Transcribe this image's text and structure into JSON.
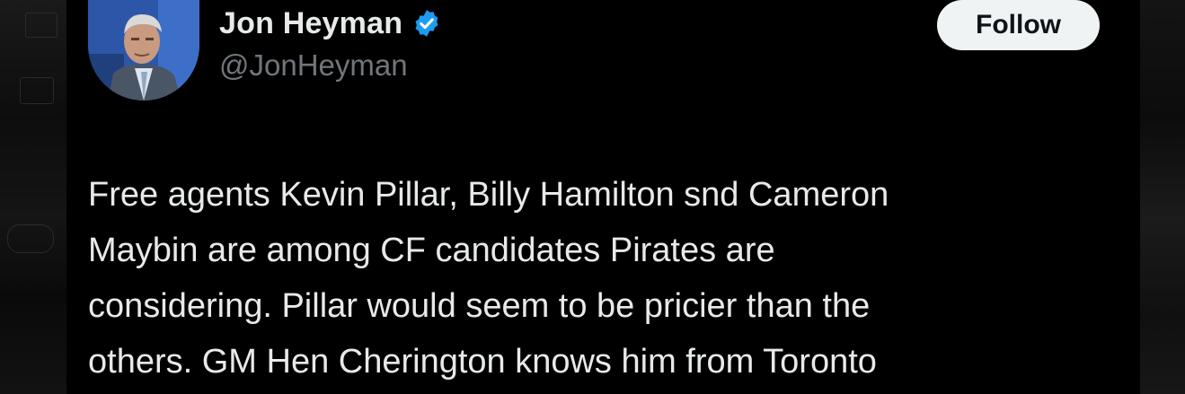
{
  "author": {
    "display_name": "Jon Heyman",
    "handle": "@JonHeyman",
    "verified": true,
    "verified_color": "#1d9bf0"
  },
  "actions": {
    "follow_label": "Follow"
  },
  "tweet": {
    "text": "Free agents Kevin Pillar, Billy Hamilton snd Cameron\nMaybin are among CF candidates Pirates are\nconsidering. Pillar would seem to be pricier than the\nothers. GM Hen Cherington knows him from Toronto"
  },
  "theme": {
    "background": "#000000",
    "text_primary": "#e7e9ea",
    "text_secondary": "#71767b",
    "button_bg": "#eff3f4"
  }
}
